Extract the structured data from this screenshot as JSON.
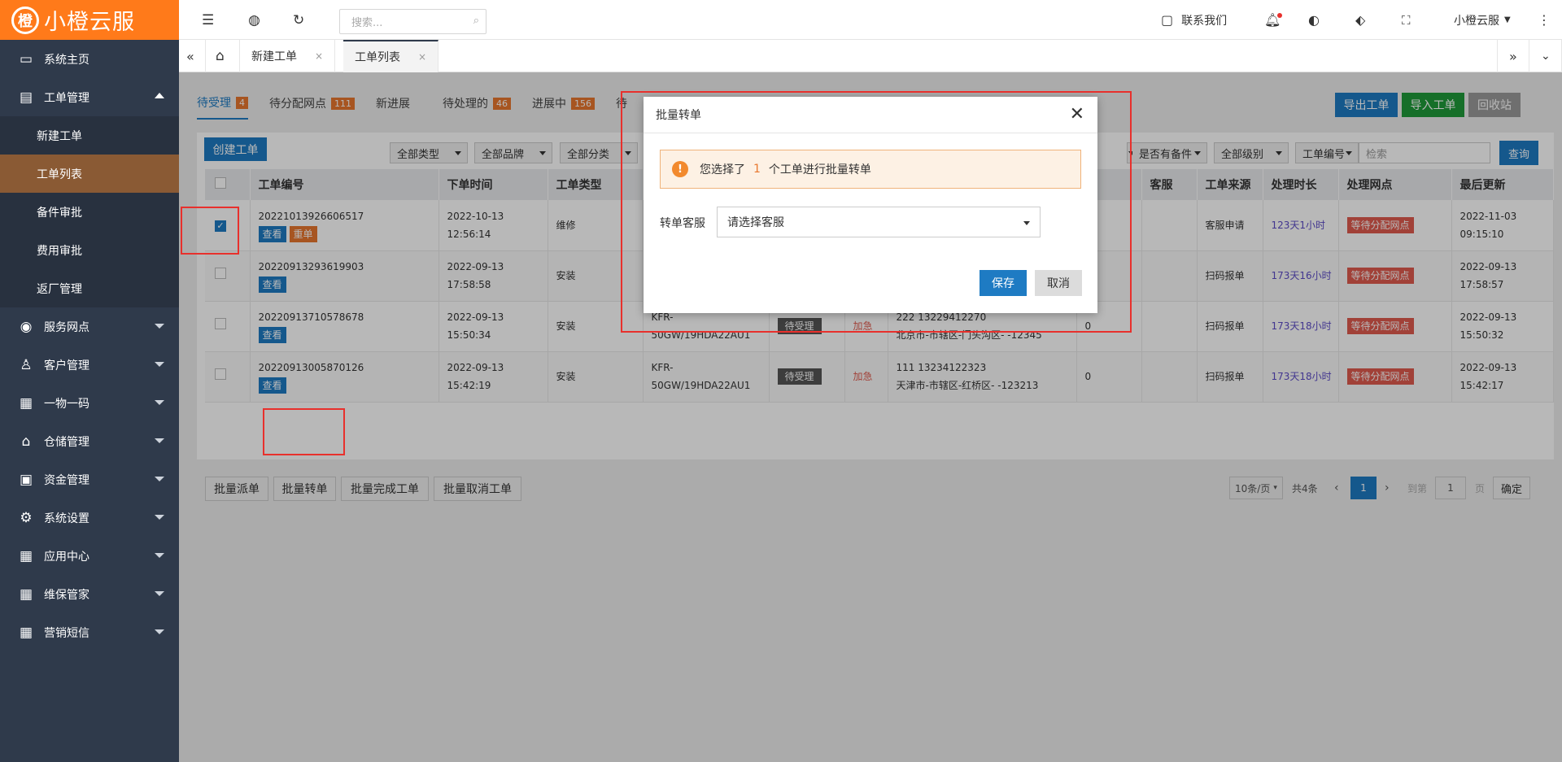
{
  "app": {
    "brand": "小橙云服",
    "logo_mark": "橙"
  },
  "sidebar": {
    "items": [
      {
        "label": "系统主页",
        "icon": "monitor-icon"
      },
      {
        "label": "工单管理",
        "icon": "document-icon",
        "expanded": true,
        "children": [
          "新建工单",
          "工单列表",
          "备件审批",
          "费用审批",
          "返厂管理"
        ],
        "active_child": "工单列表"
      },
      {
        "label": "服务网点",
        "icon": "location-icon"
      },
      {
        "label": "客户管理",
        "icon": "user-icon"
      },
      {
        "label": "一物一码",
        "icon": "grid-icon"
      },
      {
        "label": "仓储管理",
        "icon": "bank-icon"
      },
      {
        "label": "资金管理",
        "icon": "money-icon"
      },
      {
        "label": "系统设置",
        "icon": "gear-icon"
      },
      {
        "label": "应用中心",
        "icon": "grid-icon"
      },
      {
        "label": "维保管家",
        "icon": "grid-icon"
      },
      {
        "label": "营销短信",
        "icon": "grid-icon"
      }
    ]
  },
  "topbar": {
    "search_placeholder": "搜索...",
    "contact": "联系我们",
    "user": "小橙云服"
  },
  "tabs": {
    "labels": [
      "新建工单",
      "工单列表"
    ],
    "close": "×"
  },
  "status_tabs": [
    {
      "label": "待受理",
      "count": "4"
    },
    {
      "label": "待分配网点",
      "count": "111"
    },
    {
      "label": "新进展",
      "count": ""
    },
    {
      "label": "待处理的",
      "count": "46"
    },
    {
      "label": "进展中",
      "count": "156"
    },
    {
      "label": "待",
      "count": ""
    }
  ],
  "actions": {
    "export": "导出工单",
    "import": "导入工单",
    "recycle": "回收站",
    "create": "创建工单",
    "query": "查询",
    "search_placeholder": "检索"
  },
  "filters": [
    "全部类型",
    "全部品牌",
    "全部分类",
    "是否有备件",
    "全部级别",
    "工单编号"
  ],
  "table": {
    "headers": [
      "工单编号",
      "下单时间",
      "工单类型",
      "",
      "",
      "",
      "",
      "",
      "客服",
      "工单来源",
      "处理时长",
      "处理网点",
      "最后更新"
    ],
    "rows": [
      {
        "id": "20221013926606517",
        "date": "2022-10-13",
        "time": "12:56:14",
        "type": "维修",
        "model1": "",
        "model2": "",
        "status": "",
        "level": "",
        "contact": "",
        "addr": "",
        "num": "",
        "source": "客服申请",
        "duration": "123天1小时",
        "node": "等待分配网点",
        "upd_date": "2022-11-03",
        "upd_time": "09:15:10",
        "checked": true,
        "rework": "重单"
      },
      {
        "id": "20220913293619903",
        "date": "2022-09-13",
        "time": "17:58:58",
        "type": "安装",
        "model1": "",
        "model2": "",
        "status": "",
        "level": "",
        "contact": "",
        "addr": "",
        "num": "",
        "source": "扫码报单",
        "duration": "173天16小时",
        "node": "等待分配网点",
        "upd_date": "2022-09-13",
        "upd_time": "17:58:57",
        "checked": false,
        "rework": ""
      },
      {
        "id": "20220913710578678",
        "date": "2022-09-13",
        "time": "15:50:34",
        "type": "安装",
        "model1": "KFR-",
        "model2": "50GW/19HDA22AU1",
        "status": "待受理",
        "level": "加急",
        "contact": "222 13229412270",
        "addr": "北京市-市辖区-门头沟区- -12345",
        "num": "0",
        "source": "扫码报单",
        "duration": "173天18小时",
        "node": "等待分配网点",
        "upd_date": "2022-09-13",
        "upd_time": "15:50:32",
        "checked": false,
        "rework": ""
      },
      {
        "id": "20220913005870126",
        "date": "2022-09-13",
        "time": "15:42:19",
        "type": "安装",
        "model1": "KFR-",
        "model2": "50GW/19HDA22AU1",
        "status": "待受理",
        "level": "加急",
        "contact": "111 13234122323",
        "addr": "天津市-市辖区-红桥区- -123213",
        "num": "0",
        "source": "扫码报单",
        "duration": "173天18小时",
        "node": "等待分配网点",
        "upd_date": "2022-09-13",
        "upd_time": "15:42:17",
        "checked": false,
        "rework": ""
      }
    ],
    "view_label": "查看"
  },
  "bulk": [
    "批量派单",
    "批量转单",
    "批量完成工单",
    "批量取消工单"
  ],
  "pagination": {
    "per_page": "10条/页",
    "total": "共4条",
    "current": "1",
    "goto_label": "到第",
    "goto_value": "1",
    "page_unit": "页",
    "confirm": "确定"
  },
  "modal": {
    "title": "批量转单",
    "alert_prefix": "您选择了",
    "alert_count": "1",
    "alert_suffix": "个工单进行批量转单",
    "field_label": "转单客服",
    "select_placeholder": "请选择客服",
    "save": "保存",
    "cancel": "取消"
  },
  "colors": {
    "brand": "#ff7a1a",
    "primary": "#1e7bc3",
    "sidebar": "#2f3a4b",
    "highlight": "#e8302c"
  }
}
